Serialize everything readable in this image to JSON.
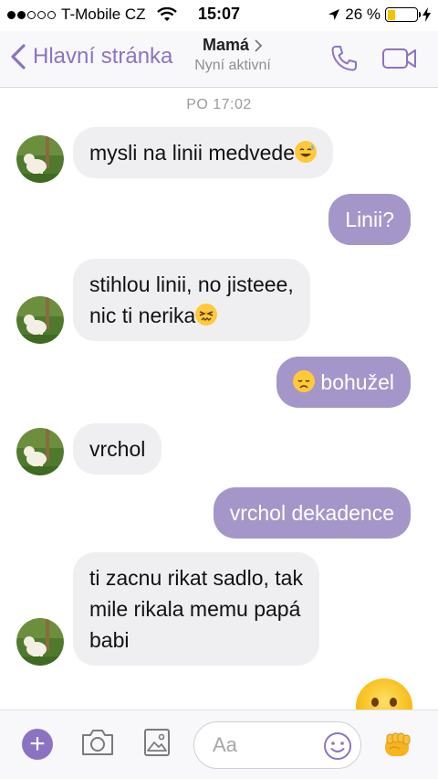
{
  "status_bar": {
    "carrier": "T-Mobile CZ",
    "time": "15:07",
    "battery": "26 %",
    "battery_level": 0.26
  },
  "header": {
    "back_label": "Hlavní stránka",
    "contact_name": "Mamá",
    "contact_status": "Nyní aktivní",
    "accent_color": "#8c73c2"
  },
  "chat": {
    "date_label": "PO 17:02",
    "messages": [
      {
        "direction": "in",
        "lines": [
          "mysli na linii medvede"
        ],
        "emoji": "grinning-sweat"
      },
      {
        "direction": "out",
        "lines": [
          "Linii?"
        ]
      },
      {
        "direction": "in",
        "lines": [
          "stihlou linii, no jisteee,",
          "nic ti nerika"
        ],
        "emoji": "persevering-face"
      },
      {
        "direction": "out",
        "lines": [
          "bohužel"
        ],
        "emoji": "disappointed-face"
      },
      {
        "direction": "in",
        "lines": [
          "vrchol"
        ]
      },
      {
        "direction": "out",
        "lines": [
          "vrchol dekadence"
        ]
      },
      {
        "direction": "in",
        "lines": [
          "ti zacnu rikat sadlo, tak",
          "mile rikala memu papá",
          "babi"
        ]
      },
      {
        "direction": "out",
        "emoji": "large-emoji-sticker"
      }
    ],
    "bubble_colors": {
      "incoming": "#efeff1",
      "outgoing": "#a596c9"
    }
  },
  "composer": {
    "placeholder": "Aa",
    "icons": [
      "plus-icon",
      "camera-icon",
      "image-icon",
      "smiley-icon",
      "like-fist-icon"
    ]
  }
}
